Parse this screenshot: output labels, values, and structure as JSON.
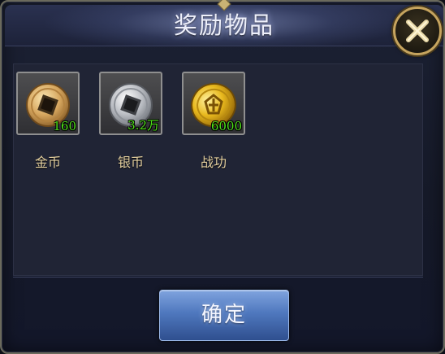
{
  "dialog": {
    "title": "奖励物品",
    "confirm_label": "确定"
  },
  "items": [
    {
      "name": "金币",
      "quantity": "160",
      "icon": "gold-coin-icon"
    },
    {
      "name": "银币",
      "quantity": "3.2万",
      "icon": "silver-coin-icon"
    },
    {
      "name": "战功",
      "quantity": "6000",
      "icon": "merit-coin-icon"
    }
  ],
  "colors": {
    "quantity_text": "#4ee019",
    "item_name_text": "#e3cf9f",
    "frame_gold": "#c6a45e",
    "button_blue": "#4f78be"
  }
}
